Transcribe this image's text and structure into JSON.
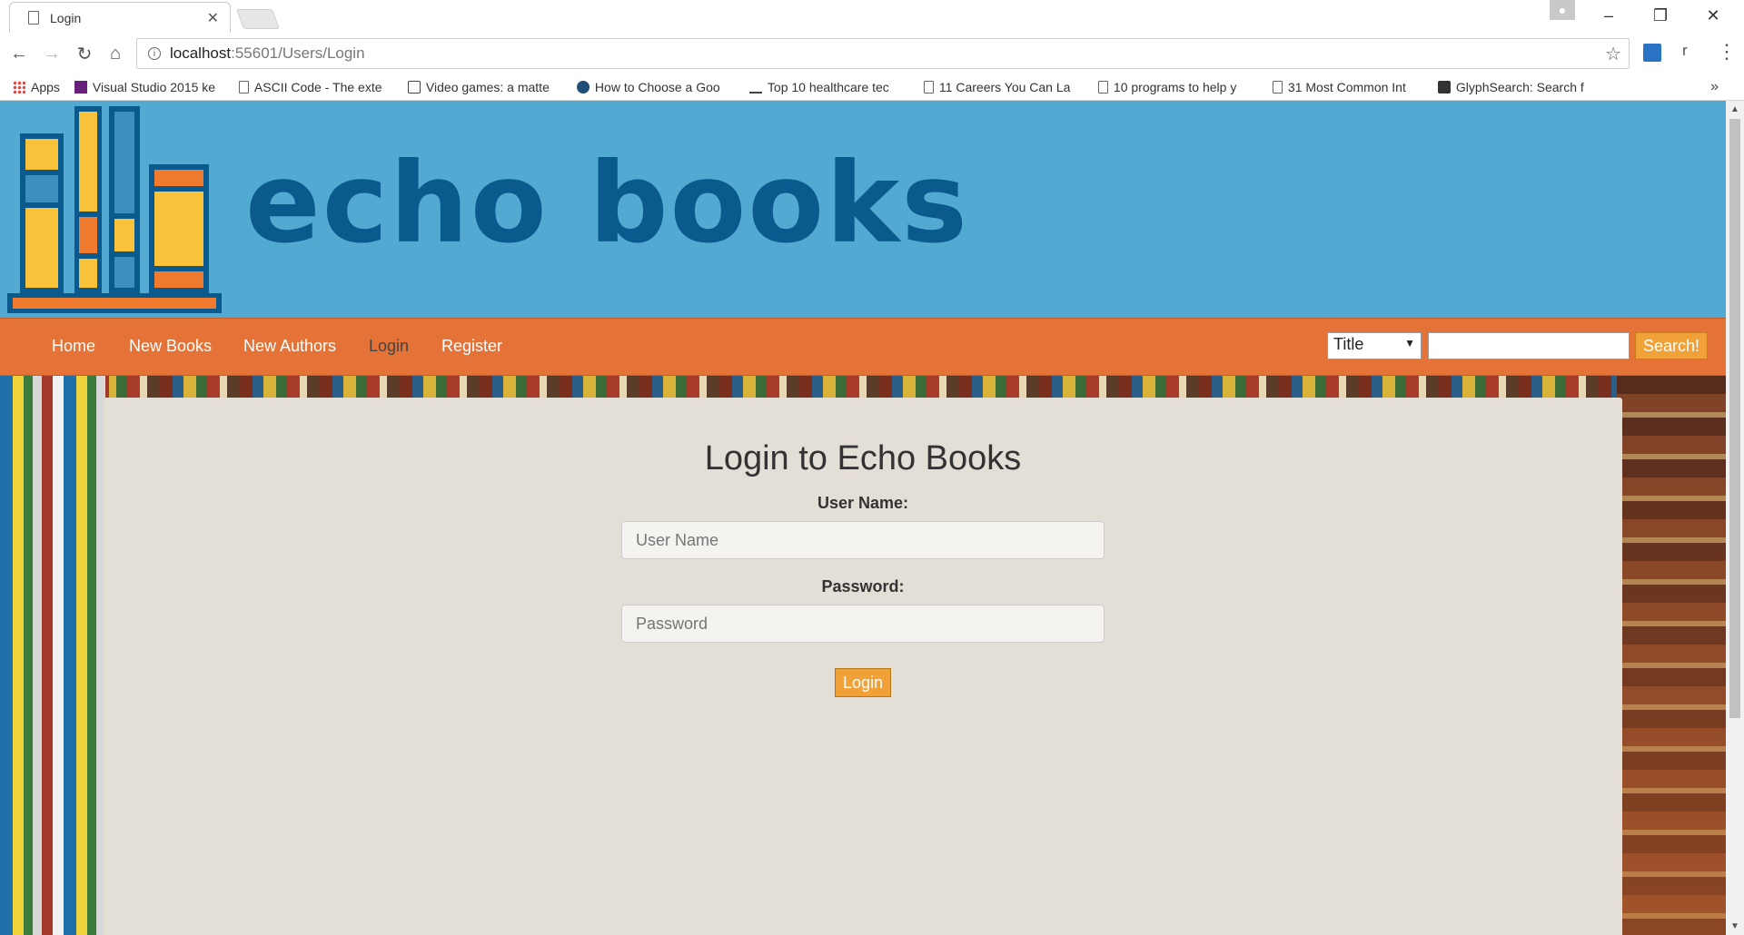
{
  "browser": {
    "tab_title": "Login",
    "url_host": "localhost",
    "url_path": ":55601/Users/Login",
    "bookmarks": [
      {
        "label": "Apps",
        "icon": "apps-grid-icon"
      },
      {
        "label": "Visual Studio 2015 ke",
        "icon": "visual-studio-icon"
      },
      {
        "label": "ASCII Code - The exte",
        "icon": "page-icon"
      },
      {
        "label": "Video games: a matte",
        "icon": "bookmark-icon"
      },
      {
        "label": "How to Choose a Goo",
        "icon": "bookmark-icon"
      },
      {
        "label": "Top 10 healthcare tec",
        "icon": "bookmark-icon"
      },
      {
        "label": "11 Careers You Can La",
        "icon": "page-icon"
      },
      {
        "label": "10 programs to help y",
        "icon": "page-icon"
      },
      {
        "label": "31 Most Common Int",
        "icon": "page-icon"
      },
      {
        "label": "GlyphSearch: Search f",
        "icon": "glyphsearch-icon"
      }
    ],
    "extension_letter": "r",
    "more_bookmarks": "»"
  },
  "site": {
    "brand": "echo books",
    "nav": [
      "Home",
      "New Books",
      "New Authors",
      "Login",
      "Register"
    ],
    "active_nav": "Login",
    "search": {
      "select_value": "Title",
      "input_value": "",
      "button_label": "Search!"
    }
  },
  "login_form": {
    "title": "Login to Echo Books",
    "username_label": "User Name:",
    "username_placeholder": "User Name",
    "password_label": "Password:",
    "password_placeholder": "Password",
    "submit_label": "Login"
  },
  "colors": {
    "header_blue": "#52a9d2",
    "brand_blue": "#0b5a8e",
    "nav_orange": "#e57236",
    "button_orange": "#f0a239"
  }
}
